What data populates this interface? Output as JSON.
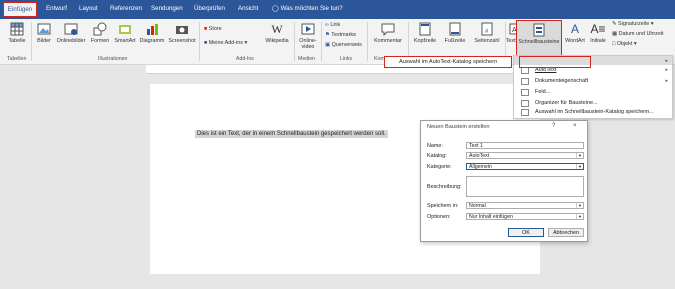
{
  "tabs": [
    "Einfügen",
    "Entwurf",
    "Layout",
    "Referenzen",
    "Sendungen",
    "Überprüfen",
    "Ansicht"
  ],
  "tell_me": "Was möchten Sie tun?",
  "ribbon": {
    "tabelle": "Tabelle",
    "bilder": "Bilder",
    "onlinebilder": "Onlinebilder",
    "formen": "Formen",
    "smartart": "SmartArt",
    "diagramm": "Diagramm",
    "screenshot": "Screenshot",
    "store": "Store",
    "meine_addins": "Meine Add-ins",
    "wikipedia": "Wikipedia",
    "onlinevideo_1": "Online-",
    "onlinevideo_2": "video",
    "link": "Link",
    "textmarke": "Textmarke",
    "querverweis": "Querverweis",
    "kommentar": "Kommentar",
    "kopfzeile": "Kopfzeile",
    "fusszeile": "Fußzeile",
    "seitenzahl": "Seitenzahl",
    "textfeld": "Textfeld",
    "schnellbausteine": "Schnellbausteine",
    "wordart": "WordArt",
    "initiale": "Initiale",
    "signaturzeile": "Signaturzeile",
    "datum_uhrzeit": "Datum und Uhrzeit",
    "objekt": "Objekt",
    "groups": {
      "tabellen": "Tabellen",
      "illustrationen": "Illustrationen",
      "addins": "Add-Ins",
      "medien": "Medien",
      "links": "Links",
      "kom": "Kom"
    }
  },
  "context_save": "Auswahl im AutoText-Katalog speichern",
  "dropdown": {
    "autotext": "AutoText",
    "dokumenteigenschaft": "Dokumenteigenschaft",
    "feld": "Feld...",
    "organizer": "Organizer für Bausteine...",
    "auswahl_speichern": "Auswahl im Schnellbaustein-Katalog speichern..."
  },
  "document_text": "Dies ist ein Text, der in einem Schnellbaustein gespeichert werden soll.",
  "dialog": {
    "title": "Neuen Baustein erstellen",
    "help": "?",
    "close": "×",
    "labels": {
      "name": "Name:",
      "katalog": "Katalog:",
      "kategorie": "Kategorie:",
      "beschreibung": "Beschreibung:",
      "speichern": "Speichern in:",
      "optionen": "Optionen:"
    },
    "values": {
      "name": "Text 1",
      "katalog": "AutoText",
      "kategorie": "Allgemein",
      "beschreibung": "",
      "speichern": "Normal",
      "optionen": "Nur Inhalt einfügen"
    },
    "ok": "OK",
    "abbrechen": "Abbrechen"
  },
  "colors": {
    "accent": "#2b579a",
    "highlight": "#d9241d"
  }
}
